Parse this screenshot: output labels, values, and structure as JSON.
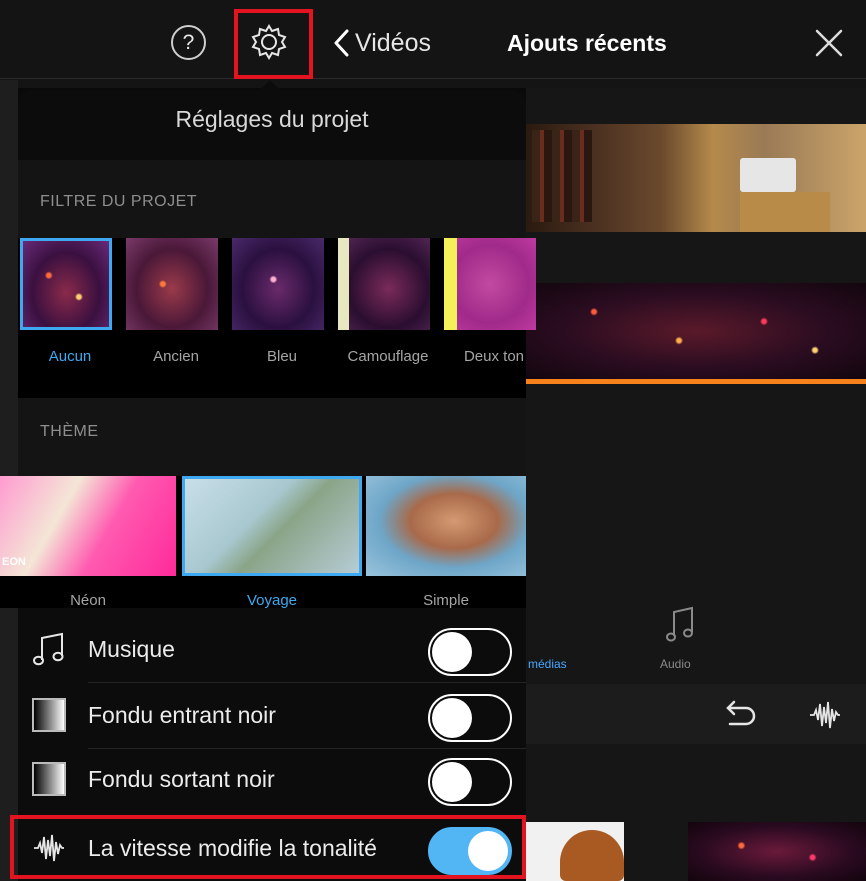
{
  "top_bar": {
    "back_label": "Vidéos",
    "title": "Ajouts récents",
    "help_glyph": "?"
  },
  "icons": {
    "help": "help-circle-icon",
    "settings": "gear-icon",
    "back": "chevron-left-icon",
    "close": "close-icon",
    "music": "music-note-icon",
    "fade_in": "fade-gradient-icon",
    "fade_out": "fade-gradient-icon",
    "speed_pitch": "waveform-icon",
    "undo": "undo-icon"
  },
  "popover": {
    "title": "Réglages du projet",
    "filter_section": "FILTRE DU PROJET",
    "theme_section": "THÈME",
    "filters": [
      {
        "label": "Aucun",
        "selected": true
      },
      {
        "label": "Ancien",
        "selected": false
      },
      {
        "label": "Bleu",
        "selected": false
      },
      {
        "label": "Camouflage",
        "selected": false
      },
      {
        "label": "Deux ton",
        "selected": false
      }
    ],
    "themes": [
      {
        "label": "Néon",
        "selected": false,
        "badge": "EON"
      },
      {
        "label": "Voyage",
        "selected": true
      },
      {
        "label": "Simple",
        "selected": false
      }
    ],
    "toggles": [
      {
        "label": "Musique",
        "on": false
      },
      {
        "label": "Fondu entrant noir",
        "on": false
      },
      {
        "label": "Fondu sortant noir",
        "on": false
      },
      {
        "label": "La vitesse modifie la tonalité",
        "on": true
      }
    ]
  },
  "background": {
    "tab_media": "médias",
    "tab_audio": "Audio"
  },
  "colors": {
    "accent": "#3ea9f0",
    "toggle_on": "#52b5f4",
    "highlight": "#e3141f",
    "timeline": "#f7821b"
  }
}
